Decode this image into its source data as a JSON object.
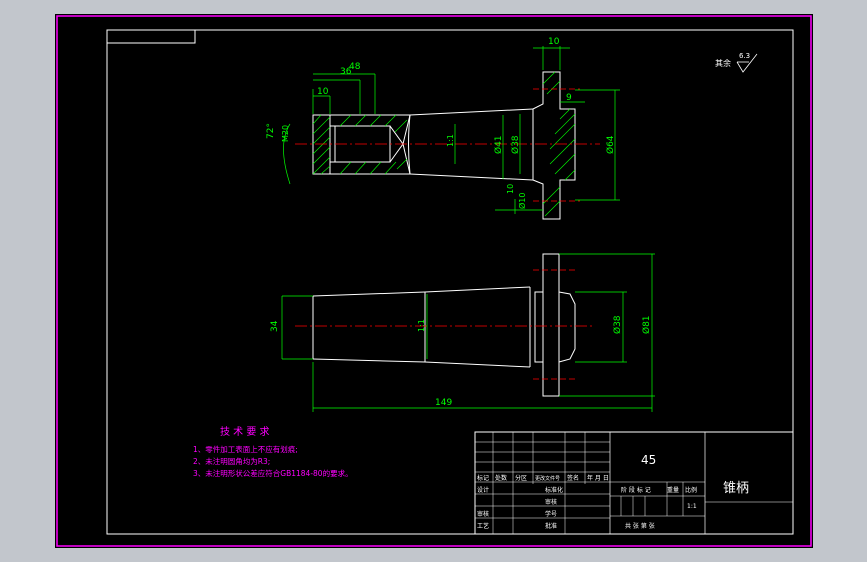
{
  "dims": {
    "d10_top": "10",
    "d36": "36",
    "d48": "48",
    "d10_left": "10",
    "angle": "72°",
    "thread": "M20",
    "taper": "1:1",
    "d41": "Ø41",
    "d38a": "Ø38",
    "d64": "Ø64",
    "d10_lower": "10",
    "d9": "9",
    "d10_small": "Ø10",
    "d34": "34",
    "taper2": "1:1",
    "d38b": "Ø38",
    "d81": "Ø81",
    "d149": "149"
  },
  "roughness": {
    "label": "其余",
    "value": "6.3"
  },
  "tech": {
    "title": "技 术 要 求",
    "items": [
      "1、零件加工表面上不应有划痕;",
      "2、未注明圆角均为R3;",
      "3、未注明形状公差应符合GB1184-80的要求。"
    ]
  },
  "titleblock": {
    "material": "45",
    "part_name": "锥柄",
    "row_labels": [
      "标记",
      "处数",
      "分区",
      "更改文件号",
      "签名",
      "年 月 日"
    ],
    "design": "设计",
    "standard": "标准化",
    "audit": "审核",
    "craft": "工艺",
    "approve": "批准",
    "student_no": "学号",
    "stage_label": "阶 段 标 记",
    "weight": "重量",
    "scale_label": "比例",
    "scale_value": "1:1",
    "sheets": "共  张 第  张"
  },
  "colors": {
    "outline": "#ffffff",
    "dimension": "#00ff00",
    "centerline": "#ff0000",
    "hatch": "#00ff00",
    "tech_text": "#ff00ff",
    "border": "#ff00ff"
  }
}
